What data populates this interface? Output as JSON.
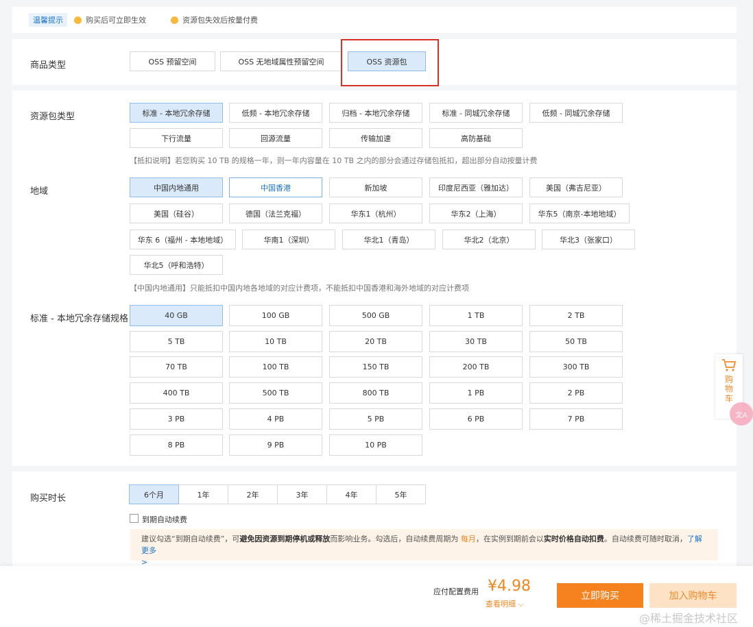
{
  "tips": {
    "tag": "温馨提示",
    "item1": "购买后可立即生效",
    "item2": "资源包失效后按量付费"
  },
  "product_type": {
    "label": "商品类型",
    "options": [
      "OSS 预留空间",
      "OSS 无地域属性预留空间",
      "OSS 资源包"
    ],
    "selected": "OSS 资源包"
  },
  "package_type": {
    "label": "资源包类型",
    "options": [
      "标准 - 本地冗余存储",
      "低频 - 本地冗余存储",
      "归档 - 本地冗余存储",
      "标准 - 同城冗余存储",
      "低频 - 同城冗余存储",
      "下行流量",
      "回源流量",
      "传输加速",
      "高防基础"
    ],
    "selected": "标准 - 本地冗余存储",
    "note": "【抵扣说明】若您购买 10 TB 的规格一年，则一年内容量在 10 TB 之内的部分会通过存储包抵扣，超出部分自动按量计费"
  },
  "region": {
    "label": "地域",
    "options": [
      "中国内地通用",
      "中国香港",
      "新加坡",
      "印度尼西亚（雅加达）",
      "美国（弗吉尼亚）",
      "美国（硅谷）",
      "德国（法兰克福）",
      "华东1（杭州）",
      "华东2（上海）",
      "华东5（南京-本地地域）",
      "华东 6（福州 - 本地地域）",
      "华南1（深圳）",
      "华北1（青岛）",
      "华北2（北京）",
      "华北3（张家口）",
      "华北5（呼和浩特）"
    ],
    "selected": "中国内地通用",
    "hover": "中国香港",
    "note": "【中国内地通用】只能抵扣中国内地各地域的对应计费项，不能抵扣中国香港和海外地域的对应计费项"
  },
  "spec": {
    "label": "标准 - 本地冗余存储规格",
    "options": [
      "40 GB",
      "100 GB",
      "500 GB",
      "1 TB",
      "2 TB",
      "5 TB",
      "10 TB",
      "20 TB",
      "30 TB",
      "50 TB",
      "70 TB",
      "100 TB",
      "150 TB",
      "200 TB",
      "300 TB",
      "400 TB",
      "500 TB",
      "800 TB",
      "1 PB",
      "2 PB",
      "3 PB",
      "4 PB",
      "5 PB",
      "6 PB",
      "7 PB",
      "8 PB",
      "9 PB",
      "10 PB"
    ],
    "selected": "40 GB"
  },
  "duration": {
    "label": "购买时长",
    "options": [
      "6个月",
      "1年",
      "2年",
      "3年",
      "4年",
      "5年"
    ],
    "selected": "6个月",
    "auto_renew_label": "到期自动续费",
    "auto_renew_checked": false
  },
  "warning": {
    "part1": "建议勾选“到期自动续费”，可",
    "bold1": "避免因资源到期停机或释放",
    "part2": "而影响业务。勾选后，自动续费周期为 ",
    "accent": "每月",
    "part3": "，在实例到期前会以",
    "bold2": "实时价格自动扣费",
    "part4": "。自动续费可随时取消，",
    "link": "了解更多",
    "arrow": ">"
  },
  "footer": {
    "price_label": "应付配置费用",
    "price": "¥4.98",
    "detail": "查看明细",
    "buy": "立即购买",
    "add_cart": "加入购物车"
  },
  "side": {
    "cart": "购物车",
    "badge": "文A"
  },
  "watermark": "@稀土掘金技术社区",
  "colors": {
    "accent": "#f5821f",
    "selected_bg": "#dbeafa",
    "link": "#1a73c9",
    "highlight": "#d93025"
  }
}
